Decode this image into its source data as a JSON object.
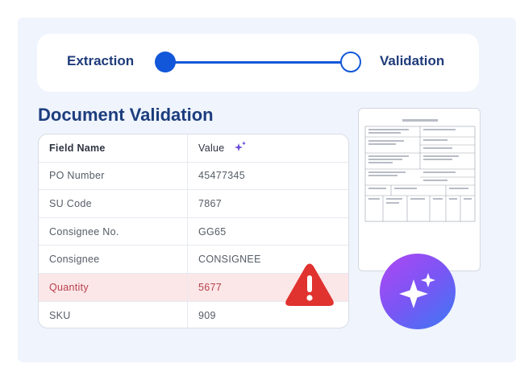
{
  "stepper": {
    "steps": [
      {
        "label": "Extraction",
        "state": "completed"
      },
      {
        "label": "Validation",
        "state": "pending"
      }
    ],
    "accent_color": "#1257d9"
  },
  "heading": "Document Validation",
  "table": {
    "headers": {
      "field": "Field Name",
      "value": "Value"
    },
    "header_icon": "sparkle-icon",
    "rows": [
      {
        "field": "PO Number",
        "value": "45477345",
        "status": "ok"
      },
      {
        "field": "SU Code",
        "value": "7867",
        "status": "ok"
      },
      {
        "field": "Consignee No.",
        "value": "GG65",
        "status": "ok"
      },
      {
        "field": "Consignee",
        "value": "CONSIGNEE",
        "status": "ok"
      },
      {
        "field": "Quantity",
        "value": "5677",
        "status": "error"
      },
      {
        "field": "SKU",
        "value": "909",
        "status": "ok"
      }
    ],
    "error_color": "#e0322f",
    "error_row_bg": "#fce7e8"
  },
  "warning_icon": "warning-triangle-icon",
  "document_preview": {
    "icon": "waybill-document-thumbnail"
  },
  "ai_badge": {
    "icon": "sparkle-icon",
    "gradient": [
      "#b047f2",
      "#3b79f2"
    ]
  }
}
